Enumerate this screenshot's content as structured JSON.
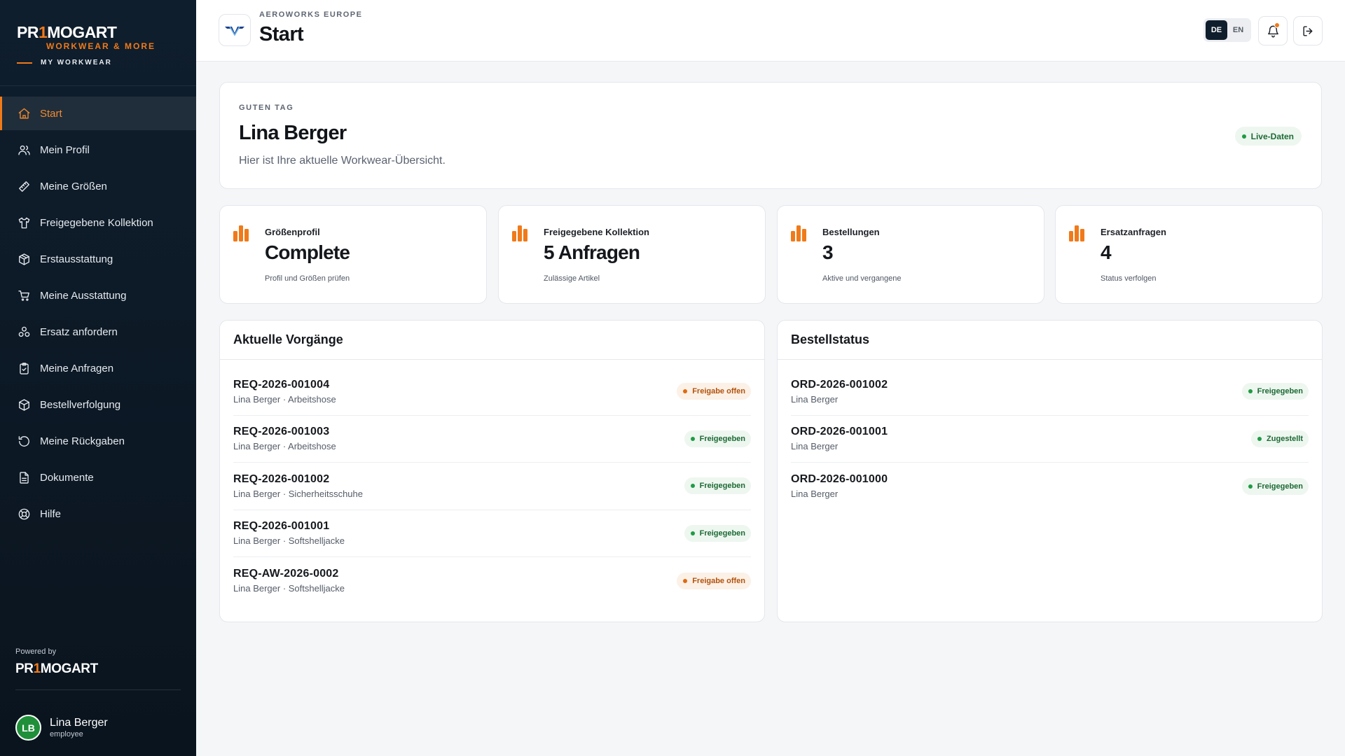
{
  "sidebar": {
    "brand": {
      "logo_a": "PR",
      "logo_one": "1",
      "logo_b": "MOGART",
      "subtitle": "WORKWEAR & MORE",
      "tagline": "MY WORKWEAR"
    },
    "items": [
      {
        "label": "Start",
        "icon": "home-icon",
        "active": true
      },
      {
        "label": "Mein Profil",
        "icon": "users-icon"
      },
      {
        "label": "Meine Größen",
        "icon": "ruler-icon"
      },
      {
        "label": "Freigegebene Kollektion",
        "icon": "shirt-icon"
      },
      {
        "label": "Erstausstattung",
        "icon": "package-icon"
      },
      {
        "label": "Meine Ausstattung",
        "icon": "cart-icon"
      },
      {
        "label": "Ersatz anfordern",
        "icon": "refresh-cycle-icon"
      },
      {
        "label": "Meine Anfragen",
        "icon": "clipboard-icon"
      },
      {
        "label": "Bestellverfolgung",
        "icon": "package-track-icon"
      },
      {
        "label": "Meine Rückgaben",
        "icon": "return-icon"
      },
      {
        "label": "Dokumente",
        "icon": "document-icon"
      },
      {
        "label": "Hilfe",
        "icon": "lifebuoy-icon"
      }
    ],
    "powered_label": "Powered by",
    "powered_logo_a": "PR",
    "powered_logo_one": "1",
    "powered_logo_b": "MOGART",
    "user": {
      "initials": "LB",
      "name": "Lina Berger",
      "role": "employee"
    }
  },
  "header": {
    "org_name": "AEROWORKS EUROPE",
    "title": "Start",
    "languages": [
      {
        "label": "DE",
        "active": true
      },
      {
        "label": "EN",
        "active": false
      }
    ]
  },
  "welcome": {
    "label": "GUTEN TAG",
    "name": "Lina Berger",
    "text": "Hier ist Ihre aktuelle Workwear-Übersicht.",
    "badge": "Live-Daten"
  },
  "stats": [
    {
      "label": "Größenprofil",
      "value": "Complete",
      "sub": "Profil und Größen prüfen"
    },
    {
      "label": "Freigegebene Kollektion",
      "value": "5 Anfragen",
      "sub": "Zulässige Artikel"
    },
    {
      "label": "Bestellungen",
      "value": "3",
      "sub": "Aktive und vergangene"
    },
    {
      "label": "Ersatzanfragen",
      "value": "4",
      "sub": "Status verfolgen"
    }
  ],
  "processes": {
    "title": "Aktuelle Vorgänge",
    "rows": [
      {
        "id": "REQ-2026-001004",
        "sub": "Lina Berger · Arbeitshose",
        "status": "Freigabe offen",
        "tone": "orange"
      },
      {
        "id": "REQ-2026-001003",
        "sub": "Lina Berger · Arbeitshose",
        "status": "Freigegeben",
        "tone": "green"
      },
      {
        "id": "REQ-2026-001002",
        "sub": "Lina Berger · Sicherheitsschuhe",
        "status": "Freigegeben",
        "tone": "green"
      },
      {
        "id": "REQ-2026-001001",
        "sub": "Lina Berger · Softshelljacke",
        "status": "Freigegeben",
        "tone": "green"
      },
      {
        "id": "REQ-AW-2026-0002",
        "sub": "Lina Berger · Softshelljacke",
        "status": "Freigabe offen",
        "tone": "orange"
      }
    ]
  },
  "orders": {
    "title": "Bestellstatus",
    "rows": [
      {
        "id": "ORD-2026-001002",
        "sub": "Lina Berger",
        "status": "Freigegeben",
        "tone": "green"
      },
      {
        "id": "ORD-2026-001001",
        "sub": "Lina Berger",
        "status": "Zugestellt",
        "tone": "green"
      },
      {
        "id": "ORD-2026-001000",
        "sub": "Lina Berger",
        "status": "Freigegeben",
        "tone": "green"
      }
    ]
  },
  "colors": {
    "accent": "#f07a1a",
    "sidebar": "#0f1e2d",
    "success": "#1f9b45",
    "warning": "#e06a10"
  }
}
